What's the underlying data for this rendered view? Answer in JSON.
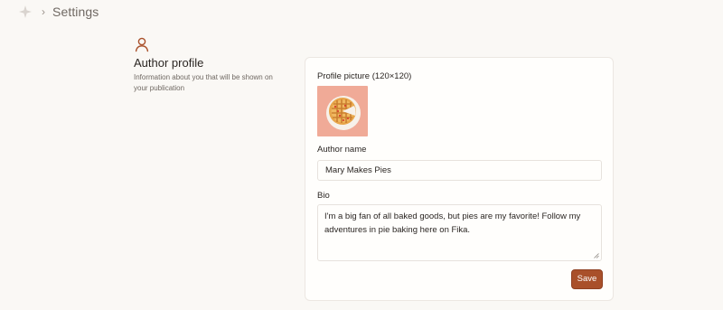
{
  "header": {
    "logo_icon": "pinwheel-logo-icon",
    "separator": "›",
    "title": "Settings"
  },
  "section": {
    "icon": "person-icon",
    "title": "Author profile",
    "description": "Information about you that will be shown on your publication"
  },
  "form": {
    "profile_picture_label": "Profile picture (120×120)",
    "profile_picture_icon": "pie-image",
    "author_name_label": "Author name",
    "author_name_value": "Mary Makes Pies",
    "bio_label": "Bio",
    "bio_value": "I'm a big fan of all baked goods, but pies are my favorite! Follow my adventures in pie baking here on Fika.",
    "save_label": "Save"
  },
  "colors": {
    "accent": "#a9502a",
    "background": "#faf8f5",
    "picture_bg": "#f0aa97"
  }
}
